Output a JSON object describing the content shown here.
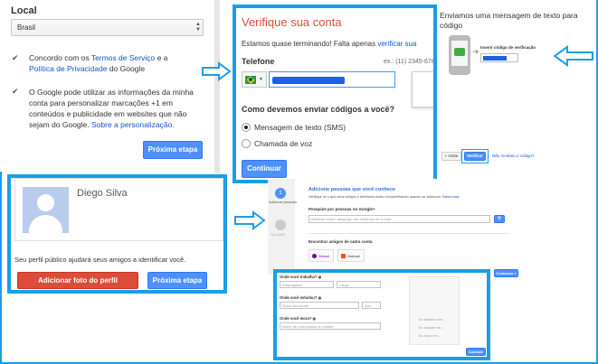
{
  "local": {
    "title": "Local",
    "country": "Brasil",
    "check": "✔",
    "terms_prefix": "Concordo com os ",
    "terms_link": "Termos de Serviço",
    "terms_mid": " e a",
    "privacy_link": "Política de Privacidade",
    "privacy_suffix": " do Google",
    "personalize_l1": "O Google pode utilizar as informações da minha",
    "personalize_l2": "conta para personalizar marcações +1 em",
    "personalize_l3": "conteúdos e publicidade em websites que não",
    "personalize_l4_text": "sejam do Google.",
    "personalize_l4_link": "Sobre a personalização.",
    "next_button": "Próxima etapa"
  },
  "profile": {
    "name": "Diego Silva",
    "hint": "Seu perfil público ajudará seus amigos a identificar você.",
    "add_photo_button": "Adicionar foto do perfil",
    "next_button": "Próxima etapa"
  },
  "verify": {
    "title": "Verifique sua conta",
    "subtitle_text": "Estamos quase terminando! Falta apenas ",
    "subtitle_link": "verificar sua",
    "phone_label": "Telefone",
    "phone_example": "ex.: (11) 2345-678",
    "question": "Como devemos enviar códigos a você?",
    "option_sms": "Mensagem de texto (SMS)",
    "option_voice": "Chamada de voz",
    "continue_button": "Continuar"
  },
  "sms_sent": {
    "title_l1": "Enviamos uma mensagem de texto para",
    "title_l2": "código",
    "code_label": "Inserir código de verificação",
    "back_button": "« Voltar",
    "verify_button": "Verificar",
    "not_received_link": "Não recebeu o código?"
  },
  "friends": {
    "step1_label": "Adicionar pessoas",
    "step2_label": "Seu perfil",
    "title": "Adicione pessoas que você conhece",
    "subtitle_text": "Verifique se o que seus amigos e familiares estão compartilhando quando se adicionar.",
    "subtitle_link": "Saiba mais",
    "search_label": "Pesquise por pessoas no Google+",
    "search_placeholder": "Adicione nome, amigo(a), um endereço de e-mail...",
    "other_account_label": "Encontrar amigos de outra conta",
    "yahoo": "Yahoo!",
    "hotmail": "Hotmail",
    "continue_button": "Continuar »"
  },
  "about": {
    "work_label": "Onde você trabalha?",
    "work_employer_placeholder": "Empregador",
    "work_role_placeholder": "Cargo",
    "study_label": "Onde você estudou?",
    "study_school_placeholder": "Nome da escola",
    "study_year_placeholder": "Ano",
    "live_label": "Onde você mora?",
    "live_placeholder": "Nome de uma cidade ou cidade",
    "side_l1": "Eu trabalho em...",
    "side_l2": "Eu estudei em...",
    "side_l3": "Eu moro em...",
    "finish_button": "Concluir"
  },
  "colors": {
    "frame": "#1a9ee6",
    "google_blue": "#4d90fe",
    "google_red": "#dd4b39",
    "title_red": "#dd4b39",
    "link": "#1155cc"
  }
}
